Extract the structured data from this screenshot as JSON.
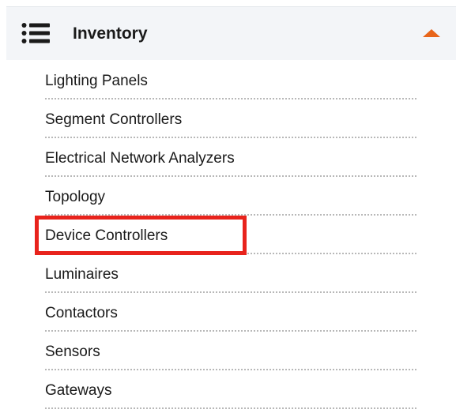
{
  "menu": {
    "title": "Inventory",
    "list_icon": "list-icon",
    "collapse_icon": "caret-up-icon",
    "accent_color": "#e8651a",
    "items": [
      {
        "label": "Lighting Panels"
      },
      {
        "label": "Segment Controllers"
      },
      {
        "label": "Electrical Network Analyzers"
      },
      {
        "label": "Topology"
      },
      {
        "label": "Device Controllers",
        "highlighted": true
      },
      {
        "label": "Luminaires"
      },
      {
        "label": "Contactors"
      },
      {
        "label": "Sensors"
      },
      {
        "label": "Gateways"
      }
    ]
  },
  "highlight": {
    "color": "#e8231c",
    "target": "Device Controllers"
  }
}
